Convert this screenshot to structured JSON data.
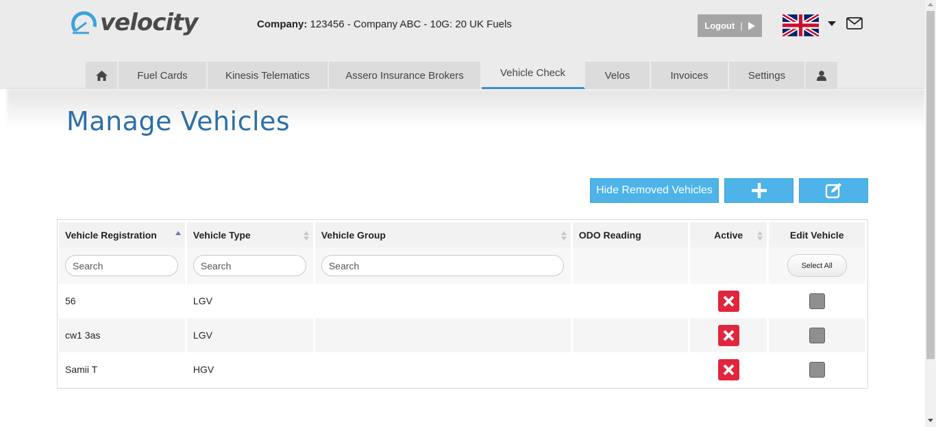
{
  "header": {
    "logo_text": "velocity",
    "company_label": "Company:",
    "company_value": "123456 - Company ABC - 10G: 20 UK Fuels",
    "logout_label": "Logout",
    "logout_sep": "|",
    "flag": "uk-flag-icon",
    "mail_icon": "envelope-icon"
  },
  "nav": {
    "items": [
      {
        "label": "",
        "icon": "home-icon"
      },
      {
        "label": "Fuel Cards"
      },
      {
        "label": "Kinesis Telematics"
      },
      {
        "label": "Assero Insurance Brokers"
      },
      {
        "label": "Vehicle Check",
        "active": true
      },
      {
        "label": "Velos"
      },
      {
        "label": "Invoices"
      },
      {
        "label": "Settings"
      },
      {
        "label": "",
        "icon": "user-icon"
      }
    ]
  },
  "page": {
    "title": "Manage Vehicles"
  },
  "actions": {
    "hide_removed_label": "Hide Removed Vehicles",
    "add_icon": "plus-icon",
    "edit_icon": "edit-icon"
  },
  "table": {
    "columns": [
      "Vehicle Registration",
      "Vehicle Type",
      "Vehicle Group",
      "ODO Reading",
      "Active",
      "Edit Vehicle"
    ],
    "search_placeholder": "Search",
    "select_all_label": "Select All",
    "rows": [
      {
        "registration": "56",
        "type": "LGV",
        "group": "",
        "odo": "",
        "active": false
      },
      {
        "registration": "cw1 3as",
        "type": "LGV",
        "group": "",
        "odo": "",
        "active": false
      },
      {
        "registration": "Samii T",
        "type": "HGV",
        "group": "",
        "odo": "",
        "active": false
      }
    ]
  },
  "colors": {
    "accent_blue": "#4db3e8",
    "title_blue": "#2c6fa6",
    "inactive_red": "#e0253c",
    "nav_active_underline": "#3a8fd0"
  }
}
